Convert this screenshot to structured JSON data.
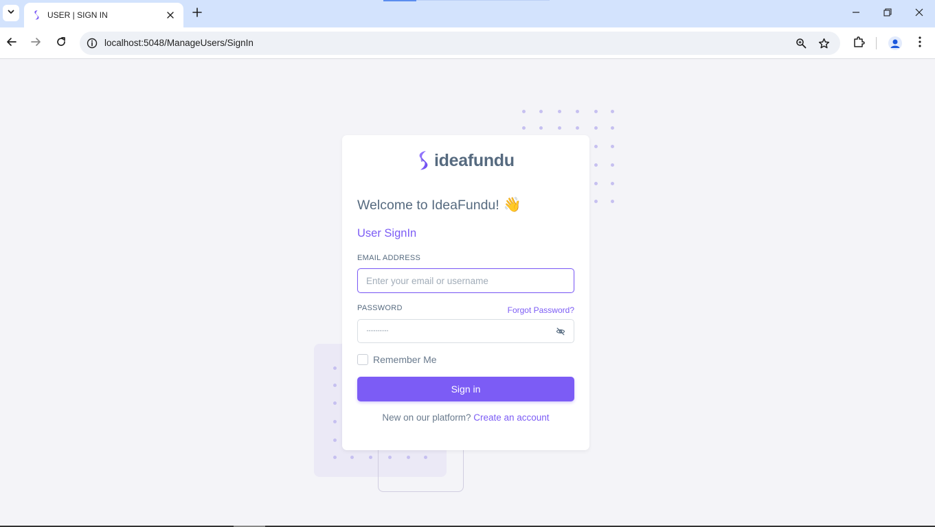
{
  "browser": {
    "tab_title": "USER | SIGN IN",
    "url": "localhost:5048/ManageUsers/SignIn",
    "icons": {
      "tab_list": "chevron-down-icon",
      "favicon": "ideafundu-logo-icon",
      "tab_close": "close-icon",
      "new_tab": "plus-icon",
      "minimize": "minimize-icon",
      "restore": "restore-icon",
      "close_window": "close-icon",
      "back": "arrow-left-icon",
      "forward": "arrow-right-icon",
      "reload": "reload-icon",
      "site_info": "info-icon",
      "zoom": "zoom-icon",
      "bookmark": "star-icon",
      "extensions": "puzzle-icon",
      "profile": "person-icon",
      "menu": "kebab-menu-icon"
    }
  },
  "colors": {
    "accent": "#7c5cf5",
    "heading": "#566a7f",
    "page_bg": "#f4f4f8",
    "tabbar_bg": "#d3e3fd"
  },
  "login": {
    "brand_name": "ideafundu",
    "welcome": "Welcome to IdeaFundu!",
    "welcome_emoji": "👋",
    "subtitle": "User SignIn",
    "email_label": "EMAIL ADDRESS",
    "email_placeholder": "Enter your email or username",
    "email_value": "",
    "password_label": "PASSWORD",
    "forgot_password": "Forgot Password?",
    "password_value": "············",
    "remember_me": "Remember Me",
    "remember_checked": false,
    "signin_button": "Sign in",
    "signup_prompt": "New on our platform?",
    "signup_link": "Create an account"
  }
}
